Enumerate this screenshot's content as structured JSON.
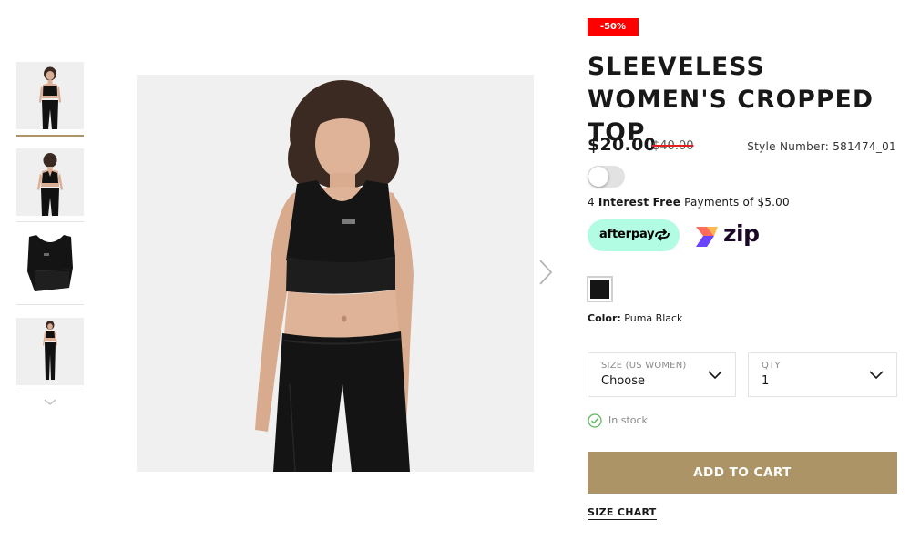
{
  "product": {
    "discount_badge": "-50%",
    "title": "SLEEVELESS WOMEN'S CROPPED TOP",
    "price": "$20.00",
    "original_price": "$40.00",
    "style_number": "Style Number: 581474_01"
  },
  "payment": {
    "installments_count": "4",
    "installments_bold": "Interest Free",
    "installments_rest": "Payments of $5.00",
    "afterpay_label": "afterpay",
    "zip_label": "zip"
  },
  "color": {
    "label": "Color:",
    "value": "Puma Black",
    "swatch_hex": "#151515"
  },
  "size_select": {
    "label": "SIZE (US WOMEN)",
    "value": "Choose"
  },
  "qty_select": {
    "label": "QTY",
    "value": "1"
  },
  "stock_status": "In stock",
  "add_to_cart_label": "ADD TO CART",
  "size_chart_label": "SIZE CHART",
  "colors": {
    "accent": "#ad9466",
    "badge": "#ff0000",
    "afterpay": "#b2fce4"
  },
  "icons": {
    "next": "chevron-right-icon",
    "thumbs_more": "chevron-down-icon",
    "stock": "check-circle-icon"
  }
}
